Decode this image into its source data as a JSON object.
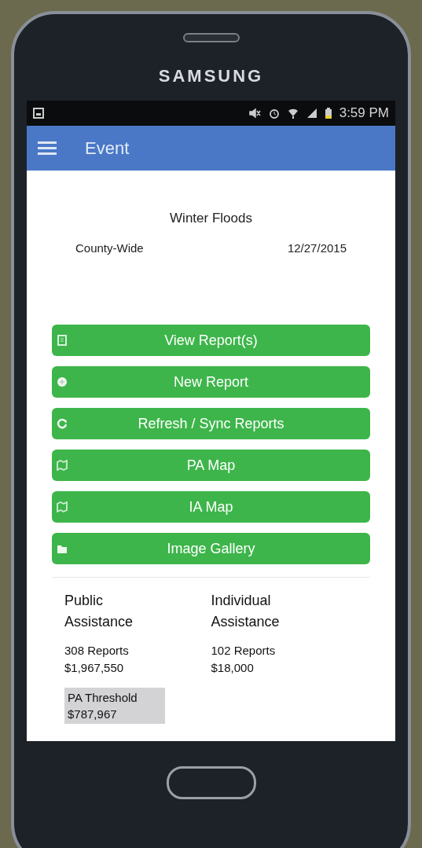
{
  "device": {
    "brand": "SAMSUNG"
  },
  "status_bar": {
    "time": "3:59 PM"
  },
  "app_bar": {
    "title": "Event"
  },
  "event": {
    "name": "Winter Floods",
    "area": "County-Wide",
    "date": "12/27/2015"
  },
  "actions": [
    {
      "label": "View Report(s)",
      "kind": "list"
    },
    {
      "label": "New Report",
      "kind": "plus"
    },
    {
      "label": "Refresh / Sync Reports",
      "kind": "refresh"
    },
    {
      "label": "PA Map",
      "kind": "map"
    },
    {
      "label": "IA Map",
      "kind": "map"
    },
    {
      "label": "Image Gallery",
      "kind": "folder"
    }
  ],
  "summary": [
    {
      "title": "Public Assistance",
      "reports": "308 Reports",
      "amount": "$1,967,550",
      "threshold": {
        "label": "PA Threshold",
        "amount": "$787,967"
      }
    },
    {
      "title": "Individual Assistance",
      "reports": "102 Reports",
      "amount": "$18,000"
    }
  ]
}
